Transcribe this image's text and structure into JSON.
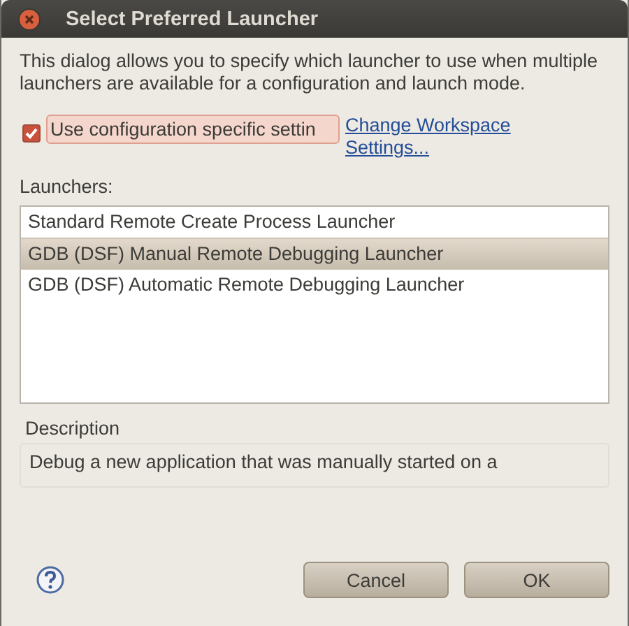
{
  "window": {
    "title": "Select Preferred Launcher"
  },
  "intro": "This dialog allows you to specify which launcher to use when multiple launchers are available for a configuration and launch mode.",
  "use_specific": {
    "label": "Use configuration specific settin",
    "checked": true
  },
  "change_link": "Change Workspace Settings...",
  "launchers_label": "Launchers:",
  "launchers": [
    {
      "name": "Standard Remote Create Process Launcher",
      "selected": false
    },
    {
      "name": "GDB (DSF) Manual Remote Debugging Launcher",
      "selected": true
    },
    {
      "name": "GDB (DSF) Automatic Remote Debugging Launcher",
      "selected": false
    }
  ],
  "description": {
    "title": "Description",
    "text": "Debug a new application that was manually started on a"
  },
  "buttons": [
    "Cancel",
    "OK"
  ]
}
